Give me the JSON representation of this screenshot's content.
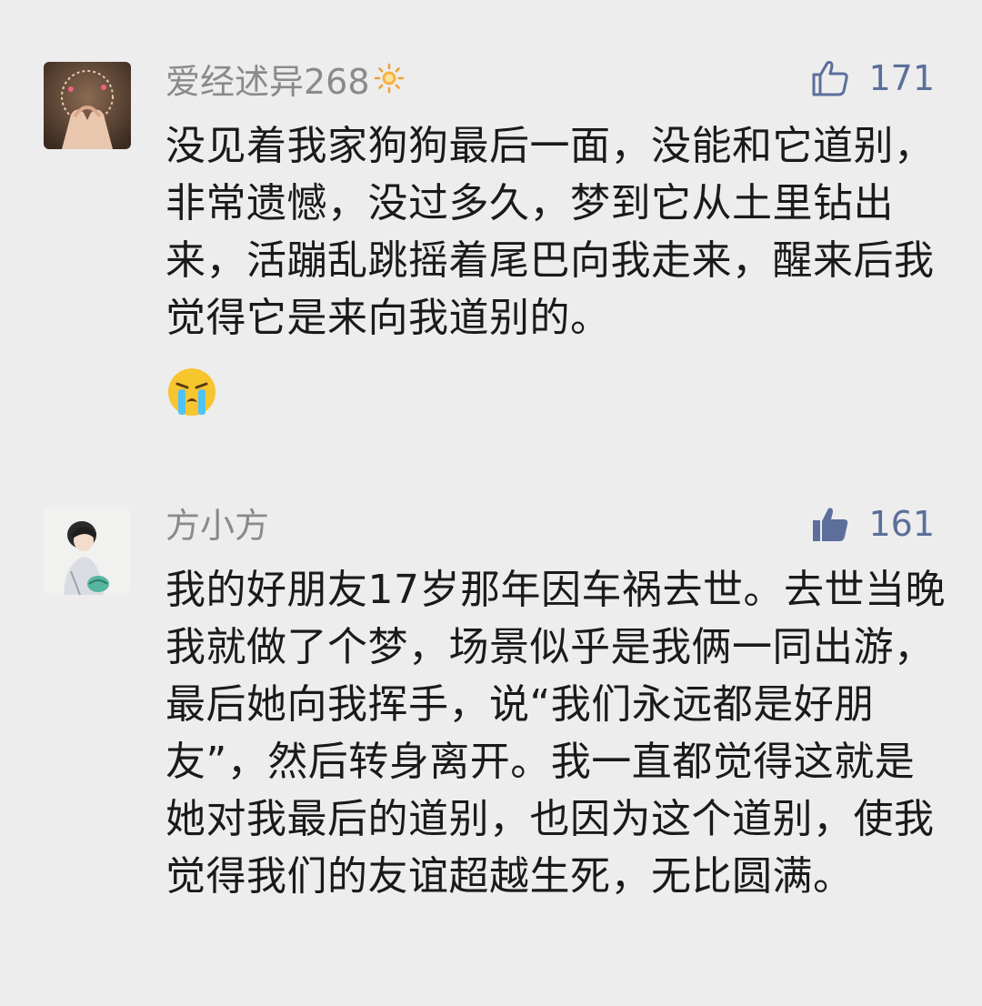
{
  "comments": [
    {
      "username": "爱经述异268",
      "user_badge_icon": "sun-icon",
      "likes": "171",
      "liked": false,
      "text": "没见着我家狗狗最后一面，没能和它道别，非常遗憾，没过多久，梦到它从土里钻出来，活蹦乱跳摇着尾巴向我走来，醒来后我觉得它是来向我道别的。",
      "emoji": "crying-face-icon"
    },
    {
      "username": "方小方",
      "likes": "161",
      "liked": true,
      "text": "我的好朋友17岁那年因车祸去世。去世当晚我就做了个梦，场景似乎是我俩一同出游，最后她向我挥手，说“我们永远都是好朋友”，然后转身离开。我一直都觉得这就是她对我最后的道别，也因为这个道别，使我觉得我们的友谊超越生死，无比圆满。"
    }
  ],
  "colors": {
    "background": "#ededed",
    "username": "#8a8a8a",
    "like_accent": "#5b6f9a",
    "text": "#1a1a1a"
  }
}
